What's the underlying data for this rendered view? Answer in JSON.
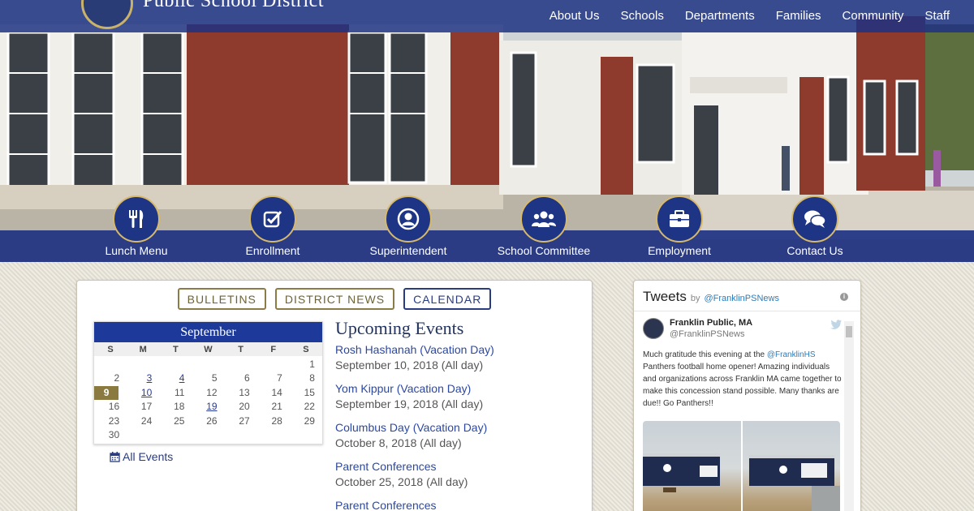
{
  "header": {
    "district_title": "Public School District",
    "nav": [
      "About Us",
      "Schools",
      "Departments",
      "Families",
      "Community",
      "Staff"
    ]
  },
  "quicklinks": [
    {
      "label": "Lunch Menu",
      "icon": "utensils-icon"
    },
    {
      "label": "Enrollment",
      "icon": "checkbox-icon"
    },
    {
      "label": "Superintendent",
      "icon": "user-circle-icon"
    },
    {
      "label": "School Committee",
      "icon": "group-icon"
    },
    {
      "label": "Employment",
      "icon": "briefcase-icon"
    },
    {
      "label": "Contact Us",
      "icon": "chat-bubbles-icon"
    }
  ],
  "tabs": {
    "bulletins": "BULLETINS",
    "district_news": "DISTRICT NEWS",
    "calendar": "CALENDAR",
    "active": "calendar"
  },
  "calendar": {
    "month": "September",
    "dow": [
      "S",
      "M",
      "T",
      "W",
      "T",
      "F",
      "S"
    ],
    "leading_blanks": 6,
    "days": 30,
    "today": 9,
    "event_days": [
      3,
      4,
      10,
      19
    ],
    "all_events": "All Events"
  },
  "events": {
    "heading": "Upcoming Events",
    "items": [
      {
        "title": "Rosh Hashanah (Vacation Day)",
        "date": "September 10, 2018 (All day)"
      },
      {
        "title": "Yom Kippur (Vacation Day)",
        "date": "September 19, 2018 (All day)"
      },
      {
        "title": "Columbus Day (Vacation Day)",
        "date": "October 8, 2018 (All day)"
      },
      {
        "title": "Parent Conferences",
        "date": "October 25, 2018 (All day)"
      },
      {
        "title": "Parent Conferences",
        "date": ""
      }
    ]
  },
  "tweets": {
    "title": "Tweets",
    "by": "by",
    "handle": "@FranklinPSNews",
    "tweet": {
      "name": "Franklin Public, MA",
      "screen_name": "@FranklinPSNews",
      "text_before": "Much gratitude this evening at the ",
      "mention": "@FranklinHS",
      "text_after": " Panthers football home opener! Amazing individuals and organizations across Franklin MA came together to make this concession stand possible. Many thanks are due!!  Go Panthers!!"
    }
  },
  "colors": {
    "nav_blue": "#1e3484",
    "gold": "#d7b96b",
    "link_blue": "#2b48a3"
  }
}
